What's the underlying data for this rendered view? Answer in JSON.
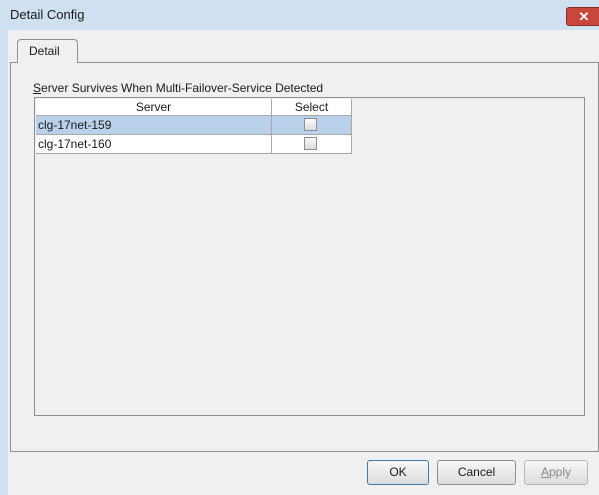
{
  "window": {
    "title": "Detail Config",
    "close_glyph": "✕"
  },
  "tabs": [
    {
      "label": "Detail"
    }
  ],
  "group": {
    "label_mnemonic": "S",
    "label_rest": "erver Survives When Multi-Failover-Service Detected"
  },
  "table": {
    "columns": [
      "Server",
      "Select"
    ],
    "rows": [
      {
        "server": "clg-17net-159",
        "selected": false,
        "highlighted": true
      },
      {
        "server": "clg-17net-160",
        "selected": false,
        "highlighted": false
      }
    ]
  },
  "buttons": {
    "ok": "OK",
    "cancel": "Cancel",
    "apply_mnemonic": "A",
    "apply_rest": "pply"
  },
  "colors": {
    "title_bar": "#cfe0f1",
    "close_button": "#c9463d",
    "selected_row": "#b9d1ea",
    "panel": "#f0f0f0"
  }
}
